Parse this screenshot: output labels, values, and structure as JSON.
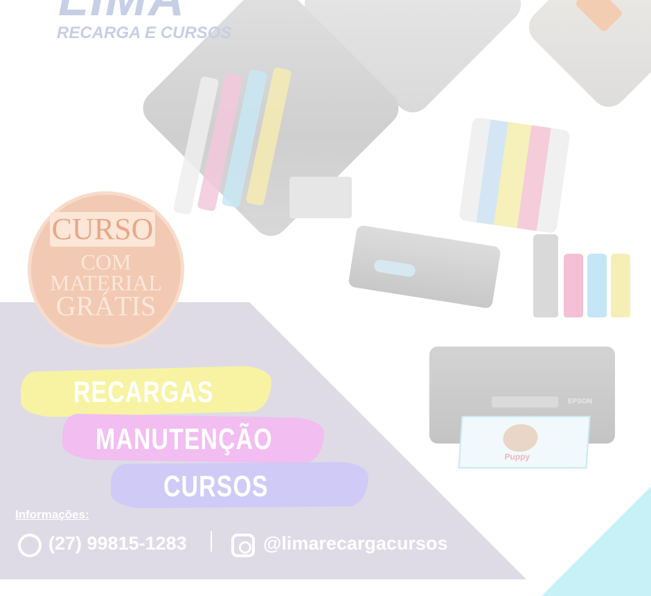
{
  "brand": {
    "name": "LIMA",
    "tagline": "RECARGA E CURSOS"
  },
  "badge": {
    "line1": "CURSO",
    "line2": "COM",
    "line3": "MATERIAL",
    "line4": "GRÁTIS"
  },
  "services": [
    "RECARGAS",
    "MANUTENÇÃO",
    "CURSOS"
  ],
  "contact": {
    "label": "Informações:",
    "phone": "(27) 99815-1283",
    "instagram": "@limarecargacursos"
  },
  "products": {
    "printer_brand": "EPSON",
    "print_caption": "Puppy"
  },
  "colors": {
    "stroke_yellow": "#f7f3a3",
    "stroke_pink": "#f2bdf0",
    "stroke_lavender": "#cfcaf6",
    "panel": "#dedbe7",
    "badge": "#f2c9b3",
    "accent_cyan": "#c8f0f7"
  },
  "icons": [
    "whatsapp-icon",
    "instagram-icon"
  ]
}
